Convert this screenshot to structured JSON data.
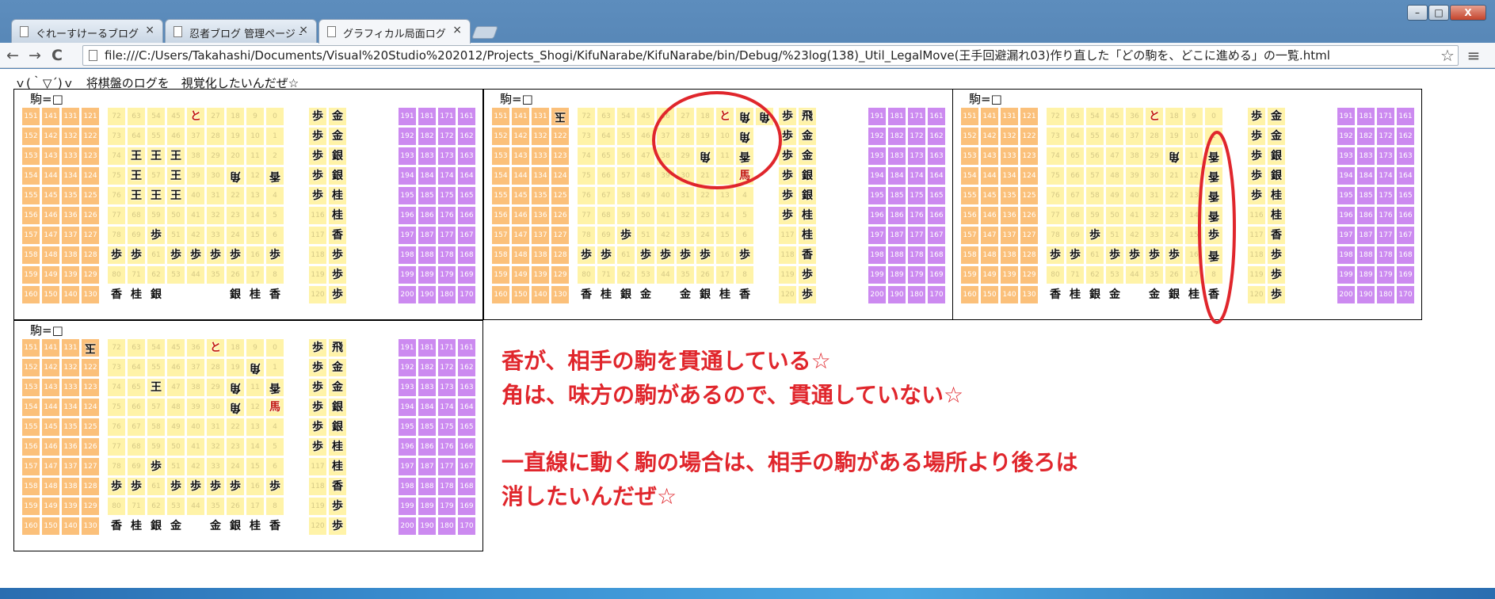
{
  "tabs": [
    {
      "title": "ぐれーすけーるブログ",
      "close": "×",
      "active": false
    },
    {
      "title": "忍者ブログ 管理ページ -",
      "close": "×",
      "active": false
    },
    {
      "title": "グラフィカル局面ログ",
      "close": "×",
      "active": true
    }
  ],
  "window_controls": {
    "minimize": "–",
    "maximize": "□",
    "close": "X"
  },
  "toolbar": {
    "back": "←",
    "forward": "→",
    "reload": "C",
    "url": "file:///C:/Users/Takahashi/Documents/Visual%20Studio%202012/Projects_Shogi/KifuNarabe/KifuNarabe/bin/Debug/%23log(138)_Util_LegalMove(王手回避漏れ03)作り直した「どの駒を、どこに進める」の一覧.html",
    "star": "☆",
    "menu": "≡"
  },
  "page": {
    "header": "ｖ(｀▽´)ｖ　将棋盤のログを　視覚化したいんだぜ☆",
    "board_label": "駒=□"
  },
  "colors": {
    "left_stand": "#fbc07a",
    "board": "#fff3a8",
    "right_stand": "#fff3a8",
    "box": "#cc8af0",
    "annotation": "#e0262c"
  },
  "grids": {
    "left_stand": [
      [
        "151",
        "141",
        "131",
        "121"
      ],
      [
        "152",
        "142",
        "132",
        "122"
      ],
      [
        "153",
        "143",
        "133",
        "123"
      ],
      [
        "154",
        "144",
        "134",
        "124"
      ],
      [
        "155",
        "145",
        "135",
        "125"
      ],
      [
        "156",
        "146",
        "136",
        "126"
      ],
      [
        "157",
        "147",
        "137",
        "127"
      ],
      [
        "158",
        "148",
        "138",
        "128"
      ],
      [
        "159",
        "149",
        "139",
        "129"
      ],
      [
        "160",
        "150",
        "140",
        "130"
      ]
    ],
    "board": [
      [
        "72",
        "63",
        "54",
        "45",
        "36",
        "27",
        "18",
        "9",
        "0"
      ],
      [
        "73",
        "64",
        "55",
        "46",
        "37",
        "28",
        "19",
        "10",
        "1"
      ],
      [
        "74",
        "65",
        "56",
        "47",
        "38",
        "29",
        "20",
        "11",
        "2"
      ],
      [
        "75",
        "66",
        "57",
        "48",
        "39",
        "30",
        "21",
        "12",
        "3"
      ],
      [
        "76",
        "67",
        "58",
        "49",
        "40",
        "31",
        "22",
        "13",
        "4"
      ],
      [
        "77",
        "68",
        "59",
        "50",
        "41",
        "32",
        "23",
        "14",
        "5"
      ],
      [
        "78",
        "69",
        "60",
        "51",
        "42",
        "33",
        "24",
        "15",
        "6"
      ],
      [
        "79",
        "70",
        "61",
        "52",
        "43",
        "34",
        "25",
        "16",
        "7"
      ],
      [
        "80",
        "71",
        "62",
        "53",
        "44",
        "35",
        "26",
        "17",
        "8"
      ]
    ],
    "right_stand": [
      [
        "111",
        "101"
      ],
      [
        "112",
        "102"
      ],
      [
        "113",
        "103"
      ],
      [
        "114",
        "104"
      ],
      [
        "115",
        "105"
      ],
      [
        "116",
        "106"
      ],
      [
        "117",
        "107"
      ],
      [
        "118",
        "108"
      ],
      [
        "119",
        "109"
      ],
      [
        "120",
        "110"
      ]
    ],
    "box": [
      [
        "191",
        "181",
        "171",
        "161"
      ],
      [
        "192",
        "182",
        "172",
        "162"
      ],
      [
        "193",
        "183",
        "173",
        "163"
      ],
      [
        "194",
        "184",
        "174",
        "164"
      ],
      [
        "195",
        "185",
        "175",
        "165"
      ],
      [
        "196",
        "186",
        "176",
        "166"
      ],
      [
        "197",
        "187",
        "177",
        "167"
      ],
      [
        "198",
        "188",
        "178",
        "168"
      ],
      [
        "199",
        "189",
        "179",
        "169"
      ],
      [
        "200",
        "190",
        "180",
        "170"
      ]
    ]
  },
  "boards": [
    {
      "left": [],
      "board": [
        [
          4,
          0,
          "と",
          "red"
        ],
        [
          1,
          2,
          "王"
        ],
        [
          2,
          2,
          "王"
        ],
        [
          3,
          2,
          "王"
        ],
        [
          1,
          3,
          "王"
        ],
        [
          3,
          3,
          "王"
        ],
        [
          1,
          4,
          "王"
        ],
        [
          2,
          4,
          "王"
        ],
        [
          3,
          4,
          "王"
        ],
        [
          6,
          3,
          "角",
          "rev"
        ],
        [
          8,
          3,
          "香",
          "rev"
        ],
        [
          2,
          6,
          "歩"
        ],
        [
          0,
          7,
          "歩"
        ],
        [
          1,
          7,
          "歩"
        ],
        [
          3,
          7,
          "歩"
        ],
        [
          4,
          7,
          "歩"
        ],
        [
          5,
          7,
          "歩"
        ],
        [
          6,
          7,
          "歩"
        ],
        [
          8,
          7,
          "歩"
        ],
        [
          0,
          9,
          "香"
        ],
        [
          1,
          9,
          "桂"
        ],
        [
          2,
          9,
          "銀"
        ],
        [
          6,
          9,
          "銀"
        ],
        [
          7,
          9,
          "桂"
        ],
        [
          8,
          9,
          "香"
        ]
      ],
      "right": [
        [
          0,
          0,
          "歩"
        ],
        [
          1,
          0,
          "金"
        ],
        [
          0,
          1,
          "歩"
        ],
        [
          1,
          1,
          "金"
        ],
        [
          0,
          2,
          "歩"
        ],
        [
          1,
          2,
          "銀"
        ],
        [
          0,
          3,
          "歩"
        ],
        [
          1,
          3,
          "銀"
        ],
        [
          0,
          4,
          "歩"
        ],
        [
          1,
          4,
          "桂"
        ],
        [
          1,
          5,
          "桂"
        ],
        [
          1,
          6,
          "香"
        ],
        [
          1,
          7,
          "歩"
        ],
        [
          1,
          8,
          "歩"
        ],
        [
          1,
          9,
          "歩"
        ]
      ]
    },
    {
      "left": [
        [
          3,
          0,
          "玉",
          "rev"
        ]
      ],
      "board": [
        [
          7,
          0,
          "と",
          "red"
        ],
        [
          8,
          0,
          "角",
          "rev"
        ],
        [
          9,
          0,
          "角",
          "rev"
        ],
        [
          8,
          1,
          "角",
          "rev"
        ],
        [
          6,
          2,
          "角",
          "rev"
        ],
        [
          8,
          2,
          "香",
          "rev"
        ],
        [
          8,
          3,
          "馬",
          "red"
        ],
        [
          2,
          6,
          "歩"
        ],
        [
          0,
          7,
          "歩"
        ],
        [
          1,
          7,
          "歩"
        ],
        [
          3,
          7,
          "歩"
        ],
        [
          4,
          7,
          "歩"
        ],
        [
          5,
          7,
          "歩"
        ],
        [
          6,
          7,
          "歩"
        ],
        [
          8,
          7,
          "歩"
        ],
        [
          0,
          9,
          "香"
        ],
        [
          1,
          9,
          "桂"
        ],
        [
          2,
          9,
          "銀"
        ],
        [
          3,
          9,
          "金"
        ],
        [
          5,
          9,
          "金"
        ],
        [
          6,
          9,
          "銀"
        ],
        [
          7,
          9,
          "桂"
        ],
        [
          8,
          9,
          "香"
        ]
      ],
      "right": [
        [
          0,
          0,
          "歩"
        ],
        [
          1,
          0,
          "飛"
        ],
        [
          0,
          1,
          "歩"
        ],
        [
          1,
          1,
          "金"
        ],
        [
          0,
          2,
          "歩"
        ],
        [
          1,
          2,
          "金"
        ],
        [
          0,
          3,
          "歩"
        ],
        [
          1,
          3,
          "銀"
        ],
        [
          0,
          4,
          "歩"
        ],
        [
          1,
          4,
          "銀"
        ],
        [
          0,
          5,
          "歩"
        ],
        [
          1,
          5,
          "桂"
        ],
        [
          1,
          6,
          "桂"
        ],
        [
          1,
          7,
          "香"
        ],
        [
          1,
          8,
          "歩"
        ],
        [
          1,
          9,
          "歩"
        ]
      ]
    },
    {
      "left": [],
      "board": [
        [
          5,
          0,
          "と",
          "red"
        ],
        [
          6,
          2,
          "角",
          "rev"
        ],
        [
          8,
          2,
          "香",
          "rev"
        ],
        [
          8,
          3,
          "香",
          "rev"
        ],
        [
          8,
          4,
          "香",
          "rev"
        ],
        [
          8,
          5,
          "香",
          "rev"
        ],
        [
          8,
          6,
          "歩"
        ],
        [
          2,
          6,
          "歩"
        ],
        [
          0,
          7,
          "歩"
        ],
        [
          1,
          7,
          "歩"
        ],
        [
          3,
          7,
          "歩"
        ],
        [
          4,
          7,
          "歩"
        ],
        [
          5,
          7,
          "歩"
        ],
        [
          6,
          7,
          "歩"
        ],
        [
          8,
          7,
          "香",
          "rev"
        ],
        [
          0,
          9,
          "香"
        ],
        [
          1,
          9,
          "桂"
        ],
        [
          2,
          9,
          "銀"
        ],
        [
          3,
          9,
          "金"
        ],
        [
          5,
          9,
          "金"
        ],
        [
          6,
          9,
          "銀"
        ],
        [
          7,
          9,
          "桂"
        ],
        [
          8,
          9,
          "香"
        ]
      ],
      "right": [
        [
          0,
          0,
          "歩"
        ],
        [
          1,
          0,
          "金"
        ],
        [
          0,
          1,
          "歩"
        ],
        [
          1,
          1,
          "金"
        ],
        [
          0,
          2,
          "歩"
        ],
        [
          1,
          2,
          "銀"
        ],
        [
          0,
          3,
          "歩"
        ],
        [
          1,
          3,
          "銀"
        ],
        [
          0,
          4,
          "歩"
        ],
        [
          1,
          4,
          "桂"
        ],
        [
          1,
          5,
          "桂"
        ],
        [
          1,
          6,
          "香"
        ],
        [
          1,
          7,
          "歩"
        ],
        [
          1,
          8,
          "歩"
        ],
        [
          1,
          9,
          "歩"
        ]
      ]
    },
    {
      "left": [
        [
          3,
          0,
          "玉",
          "rev"
        ]
      ],
      "board": [
        [
          5,
          0,
          "と",
          "red"
        ],
        [
          7,
          1,
          "角",
          "rev"
        ],
        [
          2,
          2,
          "王"
        ],
        [
          6,
          2,
          "角",
          "rev"
        ],
        [
          8,
          2,
          "香",
          "rev"
        ],
        [
          6,
          3,
          "角",
          "rev"
        ],
        [
          8,
          3,
          "馬",
          "red"
        ],
        [
          2,
          6,
          "歩"
        ],
        [
          0,
          7,
          "歩"
        ],
        [
          1,
          7,
          "歩"
        ],
        [
          3,
          7,
          "歩"
        ],
        [
          4,
          7,
          "歩"
        ],
        [
          5,
          7,
          "歩"
        ],
        [
          6,
          7,
          "歩"
        ],
        [
          8,
          7,
          "歩"
        ],
        [
          0,
          9,
          "香"
        ],
        [
          1,
          9,
          "桂"
        ],
        [
          2,
          9,
          "銀"
        ],
        [
          3,
          9,
          "金"
        ],
        [
          5,
          9,
          "金"
        ],
        [
          6,
          9,
          "銀"
        ],
        [
          7,
          9,
          "桂"
        ],
        [
          8,
          9,
          "香"
        ]
      ],
      "right": [
        [
          0,
          0,
          "歩"
        ],
        [
          1,
          0,
          "飛"
        ],
        [
          0,
          1,
          "歩"
        ],
        [
          1,
          1,
          "金"
        ],
        [
          0,
          2,
          "歩"
        ],
        [
          1,
          2,
          "金"
        ],
        [
          0,
          3,
          "歩"
        ],
        [
          1,
          3,
          "銀"
        ],
        [
          0,
          4,
          "歩"
        ],
        [
          1,
          4,
          "銀"
        ],
        [
          0,
          5,
          "歩"
        ],
        [
          1,
          5,
          "桂"
        ],
        [
          1,
          6,
          "桂"
        ],
        [
          1,
          7,
          "香"
        ],
        [
          1,
          8,
          "歩"
        ],
        [
          1,
          9,
          "歩"
        ]
      ]
    }
  ],
  "annotations": {
    "line1": "香が、相手の駒を貫通している☆",
    "line2": "角は、味方の駒があるので、貫通していない☆",
    "line3": "一直線に動く駒の場合は、相手の駒がある場所より後ろは",
    "line4": "消したいんだぜ☆"
  }
}
